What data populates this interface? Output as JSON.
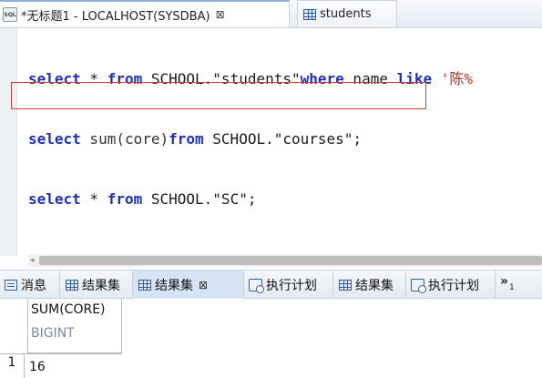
{
  "editor_tabs": [
    {
      "label": "*无标题1 - LOCALHOST(SYSDBA)",
      "close": "⊠",
      "icon": "sql-file-icon"
    },
    {
      "label": "students",
      "icon": "table-icon"
    }
  ],
  "editor": {
    "lines": [
      {
        "k1": "select",
        "t1": " * ",
        "k2": "from",
        "t2": " SCHOOL.\"students\"",
        "k3": "where",
        "t3": " name ",
        "k4": "like",
        "s1": " '陈%"
      },
      {
        "k1": "select",
        "f1": " sum(core)",
        "k2": "from",
        "t2": " SCHOOL.\"courses\";"
      },
      {
        "k1": "select",
        "t1": " * ",
        "k2": "from",
        "t2": " SCHOOL.\"SC\";"
      }
    ],
    "highlight_color": "#d23b3b"
  },
  "result_tabs": [
    {
      "label": "消息",
      "icon": "message-icon"
    },
    {
      "label": "结果集",
      "icon": "table-icon"
    },
    {
      "label": "结果集",
      "icon": "table-icon",
      "close": "⊠",
      "active": true
    },
    {
      "label": "执行计划",
      "icon": "plan-icon"
    },
    {
      "label": "结果集",
      "icon": "table-icon"
    },
    {
      "label": "执行计划",
      "icon": "plan-icon"
    }
  ],
  "overflow": {
    "chevron": "»",
    "count": "1"
  },
  "grid": {
    "column": {
      "name": "SUM(CORE)",
      "type": "BIGINT"
    },
    "rows": [
      {
        "num": "1",
        "value": "16"
      }
    ]
  },
  "colors": {
    "keyword": "#1f2fbf",
    "string": "#b42a1e",
    "active_tab": "#d6e3f5"
  }
}
